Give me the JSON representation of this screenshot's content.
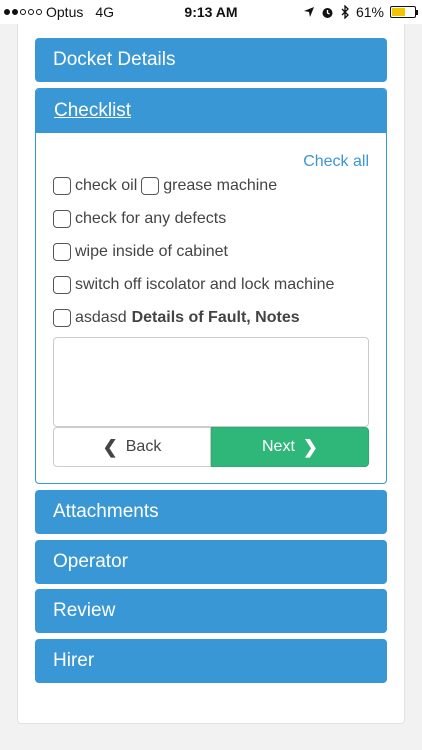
{
  "status_bar": {
    "carrier": "Optus",
    "network": "4G",
    "time": "9:13 AM",
    "battery": "61%",
    "battery_level": 0.61
  },
  "sections": {
    "docket_details": "Docket Details",
    "checklist": "Checklist",
    "attachments": "Attachments",
    "operator": "Operator",
    "review": "Review",
    "hirer": "Hirer"
  },
  "checklist": {
    "check_all": "Check all",
    "items": [
      "check oil",
      "grease machine",
      "check for any defects",
      "wipe inside of cabinet",
      "switch off iscolator and lock machine",
      "asdasd"
    ],
    "notes_label": "Details of Fault, Notes",
    "notes_value": ""
  },
  "buttons": {
    "back": "Back",
    "next": "Next"
  },
  "colors": {
    "header_blue": "#3a97d6",
    "next_green": "#2fb77a"
  }
}
